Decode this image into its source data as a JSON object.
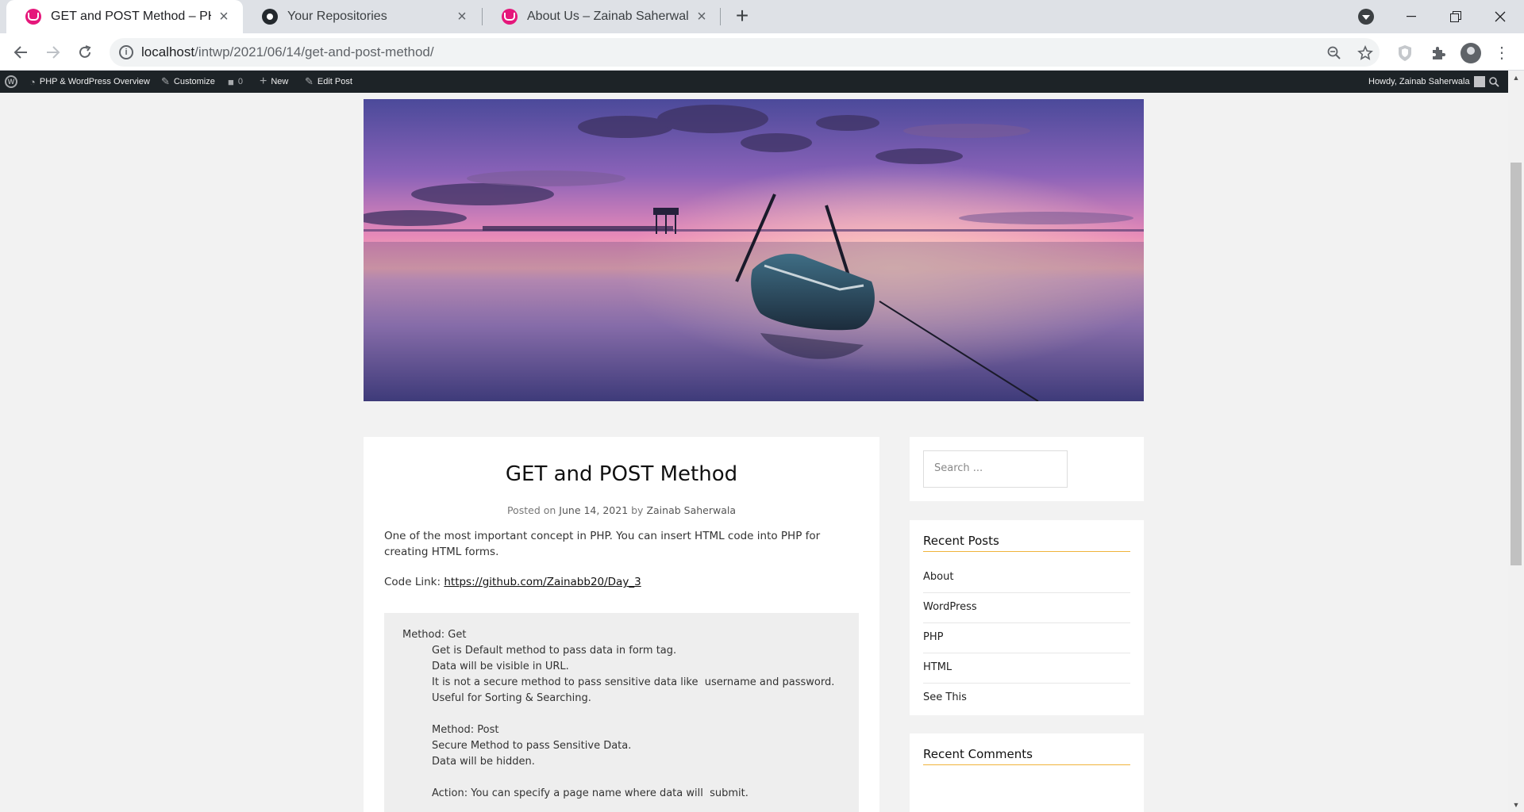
{
  "browser": {
    "tabs": [
      {
        "title": "GET and POST Method – PHP & W",
        "icon": "wamp-icon"
      },
      {
        "title": "Your Repositories",
        "icon": "github-icon"
      },
      {
        "title": "About Us – Zainab Saherwala",
        "icon": "wamp-icon"
      }
    ],
    "new_tab_label": "+",
    "close_symbol": "×",
    "url_host": "localhost",
    "url_path": "/intwp/2021/06/14/get-and-post-method/"
  },
  "adminbar": {
    "site_name": "PHP & WordPress Overview",
    "customize": "Customize",
    "comments_count": "0",
    "new": "New",
    "edit_post": "Edit Post",
    "howdy": "Howdy, Zainab Saherwala"
  },
  "post": {
    "title": "GET and POST Method",
    "meta_prefix": "Posted on",
    "date": "June 14, 2021",
    "by": "by",
    "author": "Zainab Saherwala",
    "intro": "One of the most important concept in PHP. You can insert HTML code into PHP for creating HTML forms.",
    "code_label": "Code Link:",
    "code_link": "https://github.com/Zainabb20/Day_3",
    "code_block": {
      "l1": "Method: Get",
      "l2": "Get is Default method to pass data in form tag.",
      "l3": "Data will be visible in URL.",
      "l4": "It is not a secure method to pass sensitive data like  username and password.",
      "l5": "Useful for Sorting & Searching.",
      "l6": "Method: Post",
      "l7": "Secure Method to pass Sensitive Data.",
      "l8": "Data will be hidden.",
      "l9": "Action: You can specify a page name where data will  submit."
    }
  },
  "sidebar": {
    "search_placeholder": "Search ...",
    "recent_posts_title": "Recent Posts",
    "recent_posts": [
      "About",
      "WordPress",
      "PHP",
      "HTML",
      "See This"
    ],
    "recent_comments_title": "Recent Comments"
  },
  "colors": {
    "accent_underline": "#f0b43c",
    "adminbar_bg": "#1d2327",
    "wamp_pink": "#e5177b"
  }
}
